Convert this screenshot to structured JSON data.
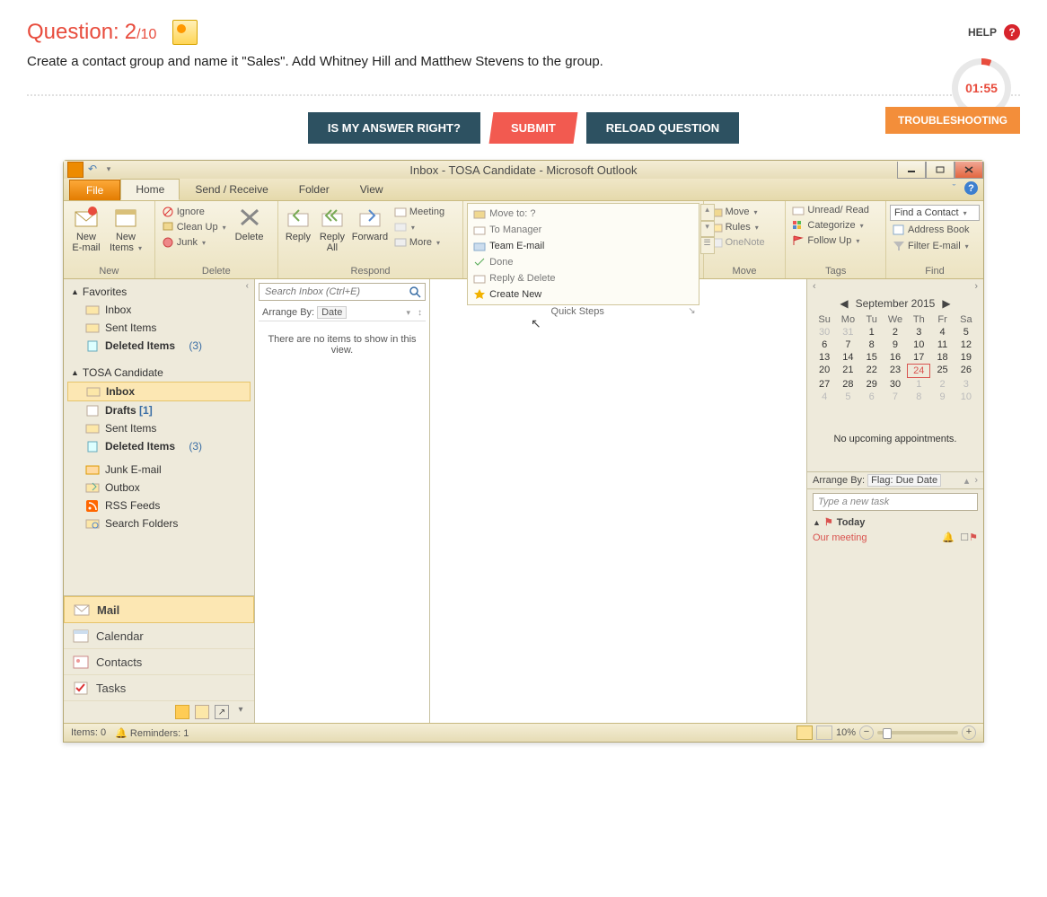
{
  "header": {
    "question_label": "Question:",
    "num": "2",
    "total": "/10",
    "help": "HELP"
  },
  "question_text": "Create a contact group and name it \"Sales\". Add Whitney Hill and Matthew Stevens to the group.",
  "timer": "01:55",
  "buttons": {
    "check": "IS MY ANSWER RIGHT?",
    "submit": "SUBMIT",
    "reload": "RELOAD QUESTION",
    "trouble": "TROUBLESHOOTING"
  },
  "outlook": {
    "title": "Inbox - TOSA Candidate  -  Microsoft Outlook",
    "tabs": {
      "file": "File",
      "home": "Home",
      "sendrecv": "Send / Receive",
      "folder": "Folder",
      "view": "View"
    },
    "ribbon": {
      "new": {
        "email": "New\nE-mail",
        "items": "New\nItems",
        "label": "New"
      },
      "delete": {
        "ignore": "Ignore",
        "cleanup": "Clean Up",
        "junk": "Junk",
        "delete": "Delete",
        "label": "Delete"
      },
      "respond": {
        "reply": "Reply",
        "replyall": "Reply\nAll",
        "forward": "Forward",
        "meeting": "Meeting",
        "more": "More",
        "label": "Respond"
      },
      "quicksteps": {
        "moveto": "Move to: ?",
        "tomanager": "To Manager",
        "teamemail": "Team E-mail",
        "done": "Done",
        "replydelete": "Reply & Delete",
        "createnew": "Create New",
        "label": "Quick Steps"
      },
      "move": {
        "move": "Move",
        "rules": "Rules",
        "onenote": "OneNote",
        "label": "Move"
      },
      "tags": {
        "unread": "Unread/ Read",
        "categorize": "Categorize",
        "followup": "Follow Up",
        "label": "Tags"
      },
      "find": {
        "contact": "Find a Contact",
        "addressbook": "Address Book",
        "filter": "Filter E-mail",
        "label": "Find"
      }
    },
    "nav": {
      "favorites": "Favorites",
      "inbox": "Inbox",
      "sent": "Sent Items",
      "deleted": "Deleted Items",
      "deleted_count": "(3)",
      "account": "TOSA Candidate",
      "drafts": "Drafts",
      "drafts_count": "[1]",
      "junk": "Junk E-mail",
      "outbox": "Outbox",
      "rss": "RSS Feeds",
      "searchf": "Search Folders",
      "mail": "Mail",
      "calendar": "Calendar",
      "contacts": "Contacts",
      "tasks": "Tasks"
    },
    "list": {
      "search_ph": "Search Inbox (Ctrl+E)",
      "arrange": "Arrange By:",
      "arrange_val": "Date",
      "empty": "There are no items to show in this view."
    },
    "cal": {
      "month": "September 2015",
      "dow": [
        "Su",
        "Mo",
        "Tu",
        "We",
        "Th",
        "Fr",
        "Sa"
      ],
      "weeks": [
        [
          "30",
          "31",
          "1",
          "2",
          "3",
          "4",
          "5"
        ],
        [
          "6",
          "7",
          "8",
          "9",
          "10",
          "11",
          "12"
        ],
        [
          "13",
          "14",
          "15",
          "16",
          "17",
          "18",
          "19"
        ],
        [
          "20",
          "21",
          "22",
          "23",
          "24",
          "25",
          "26"
        ],
        [
          "27",
          "28",
          "29",
          "30",
          "1",
          "2",
          "3"
        ],
        [
          "4",
          "5",
          "6",
          "7",
          "8",
          "9",
          "10"
        ]
      ],
      "today": "24",
      "noapt": "No upcoming appointments."
    },
    "tasks": {
      "arrange": "Arrange By:",
      "arrange_val": "Flag: Due Date",
      "new_ph": "Type a new task",
      "group": "Today",
      "item": "Our meeting"
    },
    "status": {
      "items": "Items: 0",
      "reminders": "Reminders: 1",
      "zoom": "10%"
    }
  }
}
